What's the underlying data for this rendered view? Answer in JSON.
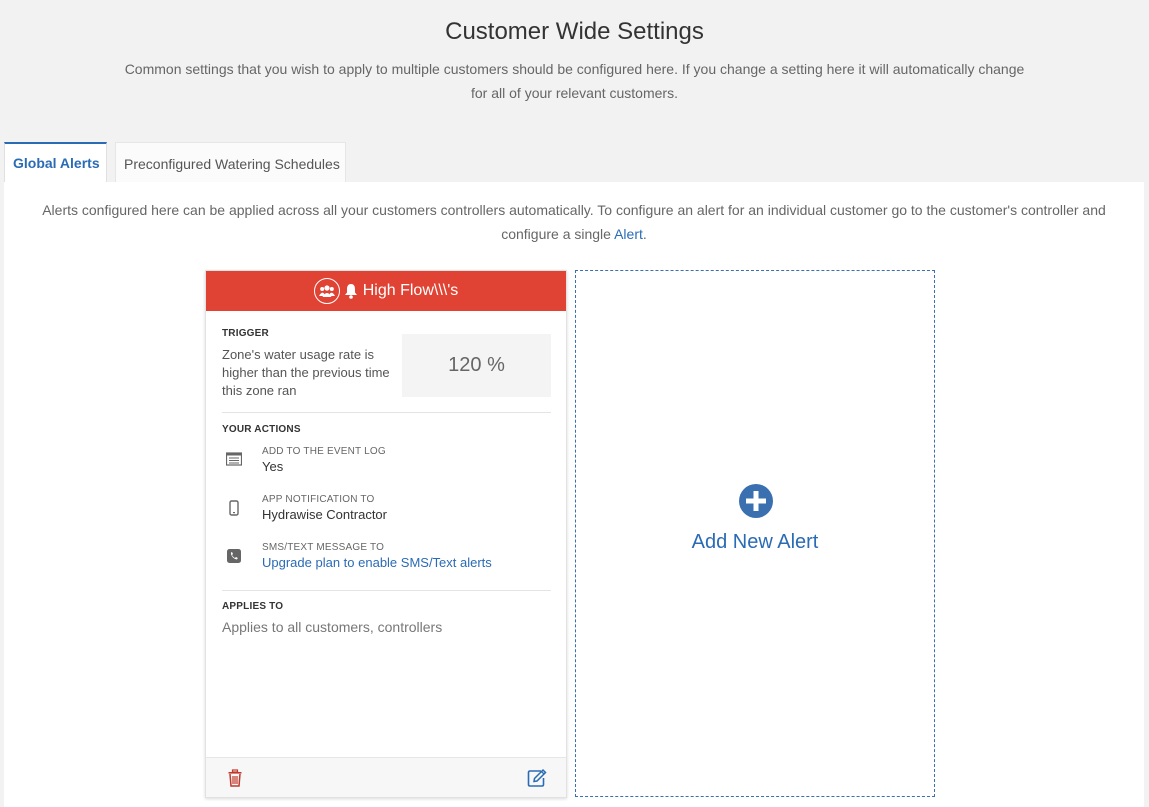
{
  "header": {
    "title": "Customer Wide Settings",
    "subtitle": "Common settings that you wish to apply to multiple customers should be configured here. If you change a setting here it will automatically change for all of your relevant customers."
  },
  "tabs": [
    {
      "label": "Global Alerts",
      "active": true
    },
    {
      "label": "Preconfigured Watering Schedules",
      "active": false
    }
  ],
  "intro": {
    "text": "Alerts configured here can be applied across all your customers controllers automatically. To configure an alert for an individual customer go to the customer's controller and configure a single",
    "link": "Alert",
    "suffix": "."
  },
  "alert_card": {
    "title": "High Flow\\\\\\'s",
    "header_color": "#e04333",
    "trigger_label": "TRIGGER",
    "trigger_desc": "Zone's water usage rate is higher than the previous time this zone ran",
    "trigger_value": "120 %",
    "actions_label": "YOUR ACTIONS",
    "actions": [
      {
        "icon": "list-icon",
        "label": "ADD TO THE EVENT LOG",
        "value": "Yes"
      },
      {
        "icon": "mobile-phone-icon",
        "label": "APP NOTIFICATION TO",
        "value": "Hydrawise Contractor"
      },
      {
        "icon": "phone-icon",
        "label": "SMS/TEXT MESSAGE TO",
        "value": "Upgrade plan to enable SMS/Text alerts"
      }
    ],
    "applies_label": "APPLIES TO",
    "applies_text": "Applies to all customers, controllers"
  },
  "add_alert": {
    "label": "Add New Alert"
  },
  "colors": {
    "accent": "#2a6bb5",
    "danger": "#e04333",
    "delete": "#c0392b"
  }
}
